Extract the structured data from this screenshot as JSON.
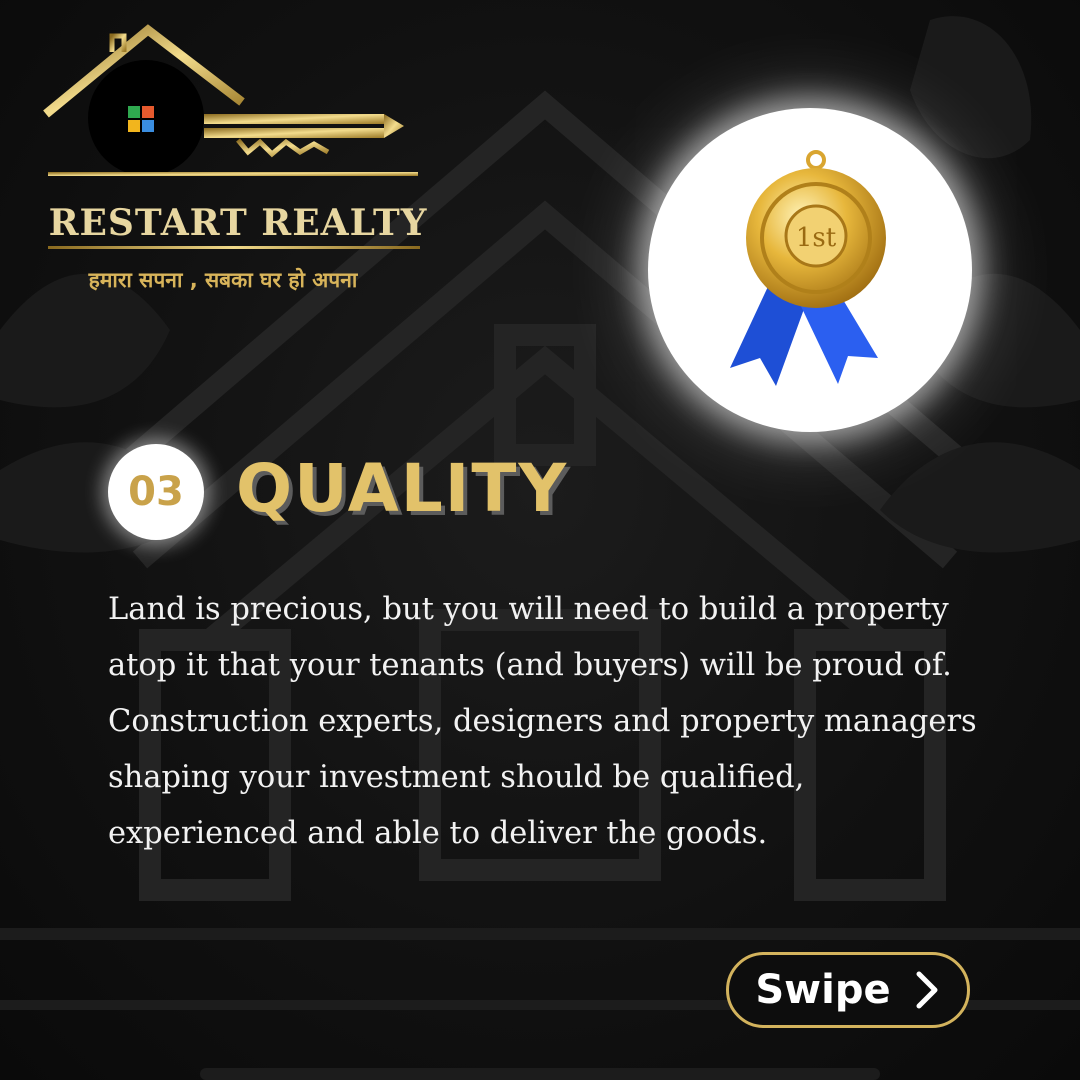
{
  "brand": {
    "name": "RESTART REALTY",
    "tagline": "हमारा सपना , सबका घर हो अपना",
    "logo_icon": "house-key-logo"
  },
  "hero": {
    "icon": "first-place-medal-icon",
    "medal_text": "1st"
  },
  "section": {
    "number": "03",
    "title": "QUALITY",
    "body": "Land is precious, but you will need to build a property atop it that your tenants (and buyers) will be proud of. Construction experts, designers and property managers shaping your investment should be qualified, experienced and able to deliver the goods."
  },
  "cta": {
    "label": "Swipe",
    "icon": "chevron-right-icon"
  },
  "colors": {
    "background": "#0f0f0f",
    "gold": "#e2c26a",
    "accent_gold": "#c9a24a",
    "text": "#f2f2f2",
    "ribbon_blue": "#1e4fd6"
  }
}
